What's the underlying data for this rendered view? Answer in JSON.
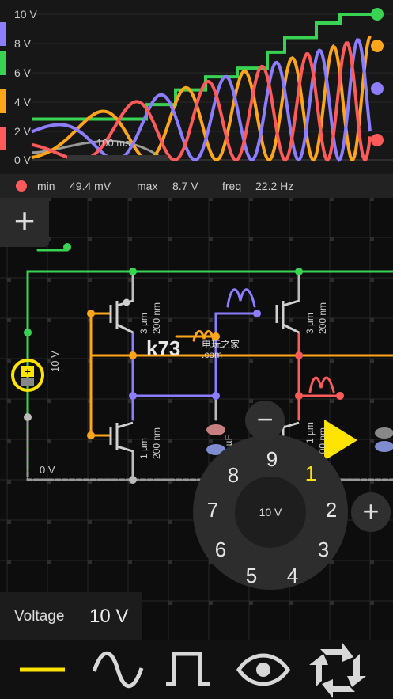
{
  "scope": {
    "y_ticks": [
      "10 V",
      "8 V",
      "6 V",
      "4 V",
      "2 V",
      "0 V"
    ],
    "time_label": "100 ms",
    "series_colors": {
      "green": "#39d353",
      "orange": "#ffa51a",
      "blue": "#8c7dff",
      "red": "#ff5a5a",
      "gray": "#bbbbbb"
    }
  },
  "stats": {
    "min_label": "min",
    "min_value": "49.4 mV",
    "max_label": "max",
    "max_value": "8.7 V",
    "freq_label": "freq",
    "freq_value": "22.2 Hz",
    "dot_color": "#ff5a5a"
  },
  "circuit": {
    "source_label": "10 V",
    "ground_label": "0 V",
    "t1": {
      "w": "3 µm",
      "l": "200 nm"
    },
    "t2": {
      "w": "3 µm",
      "l": "200 nm"
    },
    "t3": {
      "w": "1 µm",
      "l": "200 nm"
    },
    "t4": {
      "w": "1 µm",
      "l": "200 nm"
    },
    "cap_label": "00 µF",
    "watermark": "k73",
    "watermark_sub": "电玩之家",
    "watermark_url": ".com"
  },
  "dial": {
    "center_value": "10 V",
    "numbers": [
      "1",
      "2",
      "3",
      "4",
      "5",
      "6",
      "7",
      "8",
      "9"
    ],
    "selected": "1",
    "minus_label": "−",
    "plus_label": "+"
  },
  "props": {
    "label": "Voltage",
    "value": "10 V"
  },
  "add_label": "+",
  "toolbar": [
    {
      "name": "dc-tool",
      "icon": "dc-line-icon"
    },
    {
      "name": "ac-tool",
      "icon": "sine-wave-icon"
    },
    {
      "name": "pulse-tool",
      "icon": "square-wave-icon"
    },
    {
      "name": "probe-tool",
      "icon": "eye-icon"
    },
    {
      "name": "shuffle-tool",
      "icon": "cycle-arrows-icon"
    }
  ]
}
